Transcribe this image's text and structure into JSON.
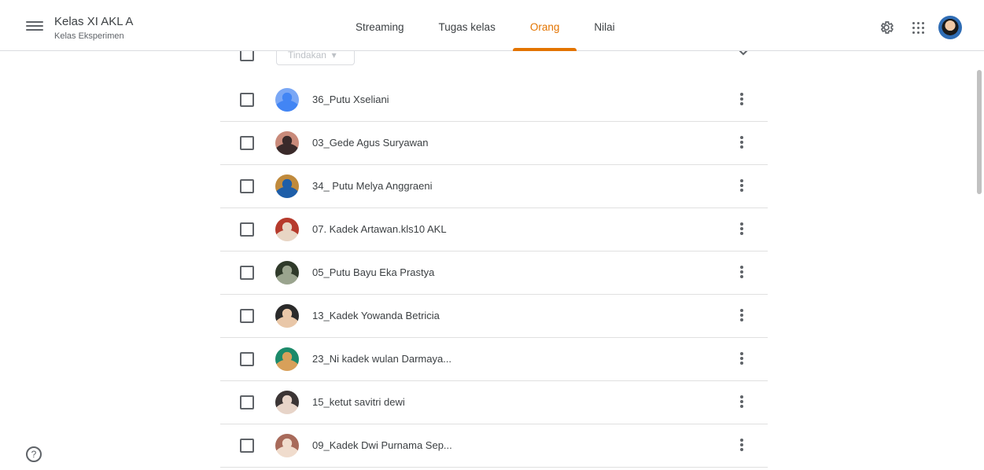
{
  "header": {
    "class_title": "Kelas XI AKL A",
    "class_subtitle": "Kelas Eksperimen",
    "tabs": [
      {
        "label": "Streaming",
        "active": false
      },
      {
        "label": "Tugas kelas",
        "active": false
      },
      {
        "label": "Orang",
        "active": true
      },
      {
        "label": "Nilai",
        "active": false
      }
    ],
    "icons": [
      "menu-icon",
      "settings-gear-icon",
      "apps-grid-icon",
      "account-avatar"
    ]
  },
  "toolbar": {
    "actions_label": "Tindakan"
  },
  "students": [
    {
      "name": "36_Putu Xseliani",
      "avatar_color": "#7aa7f5",
      "avatar_accent": "#4285f4"
    },
    {
      "name": "03_Gede Agus Suryawan",
      "avatar_color": "#c98a7a",
      "avatar_accent": "#3a2a2a"
    },
    {
      "name": "34_ Putu Melya Anggraeni",
      "avatar_color": "#c08a3c",
      "avatar_accent": "#1e5ea8"
    },
    {
      "name": "07. Kadek Artawan.kls10 AKL",
      "avatar_color": "#b63a2c",
      "avatar_accent": "#e8d5c4"
    },
    {
      "name": "05_Putu Bayu Eka Prastya",
      "avatar_color": "#2f3a2a",
      "avatar_accent": "#9aa48e"
    },
    {
      "name": "13_Kadek Yowanda Betricia",
      "avatar_color": "#2a2a2a",
      "avatar_accent": "#e9c7a8"
    },
    {
      "name": "23_Ni kadek wulan Darmaya...",
      "avatar_color": "#1c8a6a",
      "avatar_accent": "#d8a05a"
    },
    {
      "name": "15_ketut savitri dewi",
      "avatar_color": "#3b3535",
      "avatar_accent": "#e7d4c8"
    },
    {
      "name": "09_Kadek Dwi Purnama Sep...",
      "avatar_color": "#a86a5a",
      "avatar_accent": "#f0dccd"
    }
  ],
  "colors": {
    "accent": "#e37400",
    "divider": "#e0e0e0",
    "text": "#3c4043"
  },
  "help": {
    "symbol": "?"
  }
}
